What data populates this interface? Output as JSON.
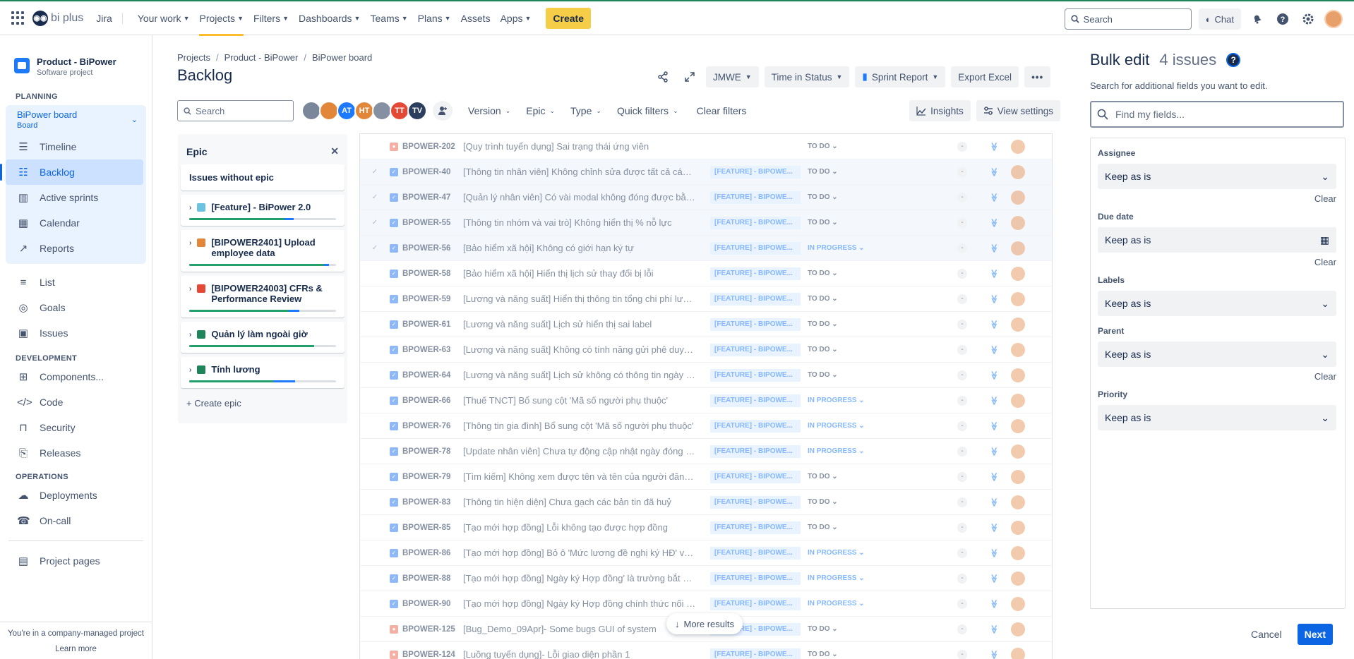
{
  "topbar": {
    "logo_text": "bi plus",
    "product": "Jira",
    "nav": [
      {
        "label": "Your work",
        "caret": true,
        "active": false
      },
      {
        "label": "Projects",
        "caret": true,
        "active": true
      },
      {
        "label": "Filters",
        "caret": true,
        "active": false
      },
      {
        "label": "Dashboards",
        "caret": true,
        "active": false
      },
      {
        "label": "Teams",
        "caret": true,
        "active": false
      },
      {
        "label": "Plans",
        "caret": true,
        "active": false
      },
      {
        "label": "Assets",
        "caret": false,
        "active": false
      },
      {
        "label": "Apps",
        "caret": true,
        "active": false
      }
    ],
    "create_label": "Create",
    "search_placeholder": "Search",
    "chat_label": "Chat"
  },
  "sidebar": {
    "project_name": "Product - BiPower",
    "project_type": "Software project",
    "planning_heading": "PLANNING",
    "board_name": "BiPower board",
    "board_sub": "Board",
    "planning_items": [
      {
        "label": "Timeline",
        "icon": "timeline-icon",
        "selected": false
      },
      {
        "label": "Backlog",
        "icon": "backlog-icon",
        "selected": true
      },
      {
        "label": "Active sprints",
        "icon": "sprints-icon",
        "selected": false
      },
      {
        "label": "Calendar",
        "icon": "calendar-icon",
        "selected": false
      },
      {
        "label": "Reports",
        "icon": "reports-icon",
        "selected": false
      }
    ],
    "other_items": [
      {
        "label": "List",
        "icon": "list-icon"
      },
      {
        "label": "Goals",
        "icon": "goals-icon"
      },
      {
        "label": "Issues",
        "icon": "issues-icon"
      }
    ],
    "development_heading": "DEVELOPMENT",
    "development_items": [
      {
        "label": "Components...",
        "icon": "components-icon"
      },
      {
        "label": "Code",
        "icon": "code-icon"
      },
      {
        "label": "Security",
        "icon": "lock-icon"
      },
      {
        "label": "Releases",
        "icon": "releases-icon"
      }
    ],
    "operations_heading": "OPERATIONS",
    "operations_items": [
      {
        "label": "Deployments",
        "icon": "deployments-icon"
      },
      {
        "label": "On-call",
        "icon": "on-call-icon"
      }
    ],
    "project_pages": "Project pages",
    "footer_text": "You're in a company-managed project",
    "learn_more": "Learn more"
  },
  "main": {
    "breadcrumbs": [
      "Projects",
      "Product - BiPower",
      "BiPower board"
    ],
    "title": "Backlog",
    "header_buttons": {
      "jmwe": "JMWE",
      "time_in_status": "Time in Status",
      "sprint_report": "Sprint Report",
      "export_excel": "Export Excel"
    },
    "search_placeholder": "Search",
    "avatars": [
      {
        "initials": "",
        "color": "#7a869a"
      },
      {
        "initials": "",
        "color": "#e2873a"
      },
      {
        "initials": "AT",
        "color": "#1d7afc"
      },
      {
        "initials": "HT",
        "color": "#e2873a"
      },
      {
        "initials": "",
        "color": "#8590a2"
      },
      {
        "initials": "TT",
        "color": "#e34935"
      },
      {
        "initials": "TV",
        "color": "#2c3e5d"
      }
    ],
    "filters": [
      "Version",
      "Epic",
      "Type",
      "Quick filters"
    ],
    "clear_filters": "Clear filters",
    "insights": "Insights",
    "view_settings": "View settings"
  },
  "epic_panel": {
    "title": "Epic",
    "no_epic": "Issues without epic",
    "epics": [
      {
        "name": "[Feature] - BiPower 2.0",
        "color": "#6cc3e0",
        "done": 0.65,
        "progress": 0.06
      },
      {
        "name": "[BIPOWER2401] Upload employee data",
        "color": "#e2873a",
        "done": 0.92,
        "progress": 0.03
      },
      {
        "name": "[BIPOWER24003] CFRs & Performance Review",
        "color": "#e34935",
        "done": 0.68,
        "progress": 0.07
      },
      {
        "name": "Quản lý làm ngoài giờ",
        "color": "#1f845a",
        "done": 0.85,
        "progress": 0.0
      },
      {
        "name": "Tính lương",
        "color": "#1f845a",
        "done": 0.57,
        "progress": 0.15
      }
    ],
    "create_epic": "Create epic"
  },
  "issues": [
    {
      "key": "BPOWER-202",
      "summary": "[Quy trình tuyển dụng] Sai trạng thái ứng viên",
      "epic": "",
      "status": "TO DO",
      "type": "bug",
      "selected": false,
      "checked": false
    },
    {
      "key": "BPOWER-40",
      "summary": "[Thông tin nhân viên] Không chỉnh sửa được tất cả các t...",
      "epic": "[FEATURE] - BIPOWE...",
      "status": "TO DO",
      "type": "task",
      "selected": true,
      "checked": true
    },
    {
      "key": "BPOWER-47",
      "summary": "[Quản lý nhân viên] Có vài modal không đóng được bằn...",
      "epic": "[FEATURE] - BIPOWE...",
      "status": "TO DO",
      "type": "task",
      "selected": true,
      "checked": true
    },
    {
      "key": "BPOWER-55",
      "summary": "[Thông tin nhóm và vai trò] Không hiển thị % nỗ lực",
      "epic": "[FEATURE] - BIPOWE...",
      "status": "TO DO",
      "type": "task",
      "selected": true,
      "checked": true
    },
    {
      "key": "BPOWER-56",
      "summary": "[Bảo hiểm xã hội] Không có giới hạn ký tự",
      "epic": "[FEATURE] - BIPOWE...",
      "status": "IN PROGRESS",
      "type": "task",
      "selected": true,
      "checked": true
    },
    {
      "key": "BPOWER-58",
      "summary": "[Bảo hiểm xã hội] Hiển thị lịch sử thay đổi bị lỗi",
      "epic": "[FEATURE] - BIPOWE...",
      "status": "TO DO",
      "type": "task",
      "selected": false,
      "checked": false
    },
    {
      "key": "BPOWER-59",
      "summary": "[Lương và năng suất] Hiển thị thông tin tổng chi phí lươn...",
      "epic": "[FEATURE] - BIPOWE...",
      "status": "TO DO",
      "type": "task",
      "selected": false,
      "checked": false
    },
    {
      "key": "BPOWER-61",
      "summary": "[Lương và năng suất] Lịch sử hiển thị sai label",
      "epic": "[FEATURE] - BIPOWE...",
      "status": "TO DO",
      "type": "task",
      "selected": false,
      "checked": false
    },
    {
      "key": "BPOWER-63",
      "summary": "[Lương và năng suất] Không có tính năng gửi phê duyệt ...",
      "epic": "[FEATURE] - BIPOWE...",
      "status": "TO DO",
      "type": "task",
      "selected": false,
      "checked": false
    },
    {
      "key": "BPOWER-64",
      "summary": "[Lương và năng suất] Lịch sử không có thông tin ngày t...",
      "epic": "[FEATURE] - BIPOWE...",
      "status": "TO DO",
      "type": "task",
      "selected": false,
      "checked": false
    },
    {
      "key": "BPOWER-66",
      "summary": "[Thuế TNCT] Bổ sung cột 'Mã số người phụ thuộc'",
      "epic": "[FEATURE] - BIPOWE...",
      "status": "IN PROGRESS",
      "type": "task",
      "selected": false,
      "checked": false
    },
    {
      "key": "BPOWER-76",
      "summary": "[Thông tin gia đình] Bổ sung cột 'Mã số người phụ thuộc'",
      "epic": "[FEATURE] - BIPOWE...",
      "status": "IN PROGRESS",
      "type": "task",
      "selected": false,
      "checked": false
    },
    {
      "key": "BPOWER-78",
      "summary": "[Update nhân viên] Chưa tự động cập nhật ngày đóng B...",
      "epic": "[FEATURE] - BIPOWE...",
      "status": "IN PROGRESS",
      "type": "task",
      "selected": false,
      "checked": false
    },
    {
      "key": "BPOWER-79",
      "summary": "[Tìm kiếm] Không xem được tên và tên của người đăng ký",
      "epic": "[FEATURE] - BIPOWE...",
      "status": "TO DO",
      "type": "task",
      "selected": false,
      "checked": false
    },
    {
      "key": "BPOWER-83",
      "summary": "[Thông tin hiện diện] Chưa gạch các bản tin đã huỷ",
      "epic": "[FEATURE] - BIPOWE...",
      "status": "TO DO",
      "type": "task",
      "selected": false,
      "checked": false
    },
    {
      "key": "BPOWER-85",
      "summary": "[Tạo mới hợp đồng] Lỗi không tạo được hợp đồng",
      "epic": "[FEATURE] - BIPOWE...",
      "status": "TO DO",
      "type": "task",
      "selected": false,
      "checked": false
    },
    {
      "key": "BPOWER-86",
      "summary": "[Tạo mới hợp đồng] Bỏ ô 'Mức lương đề nghị ký HĐ' với ...",
      "epic": "[FEATURE] - BIPOWE...",
      "status": "IN PROGRESS",
      "type": "task",
      "selected": false,
      "checked": false
    },
    {
      "key": "BPOWER-88",
      "summary": "[Tạo mới hợp đồng] Ngày ký Hợp đồng' là trường bắt bu...",
      "epic": "[FEATURE] - BIPOWE...",
      "status": "IN PROGRESS",
      "type": "task",
      "selected": false,
      "checked": false
    },
    {
      "key": "BPOWER-90",
      "summary": "[Tạo mới hợp đồng] Ngày ký Hợp đồng chính thức nối ti...",
      "epic": "[FEATURE] - BIPOWE...",
      "status": "IN PROGRESS",
      "type": "task",
      "selected": false,
      "checked": false
    },
    {
      "key": "BPOWER-125",
      "summary": "[Bug_Demo_09Apr]- Some bugs GUI of system",
      "epic": "[FEATURE] - BIPOWE...",
      "status": "TO DO",
      "type": "bug",
      "selected": false,
      "checked": false
    },
    {
      "key": "BPOWER-124",
      "summary": "[Luồng tuyển dụng]- Lỗi giao diện phần 1",
      "epic": "[FEATURE] - BIPOWE...",
      "status": "TO DO",
      "type": "bug",
      "selected": false,
      "checked": false
    }
  ],
  "more_results": "More results",
  "bulk_edit": {
    "title": "Bulk edit",
    "count": "4 issues",
    "description": "Search for additional fields you want to edit.",
    "find_placeholder": "Find my fields...",
    "fields": [
      {
        "label": "Assignee",
        "value": "Keep as is",
        "clear": "Clear",
        "control": "select"
      },
      {
        "label": "Due date",
        "value": "Keep as is",
        "clear": "Clear",
        "control": "date"
      },
      {
        "label": "Labels",
        "value": "Keep as is",
        "clear": "",
        "control": "select"
      },
      {
        "label": "Parent",
        "value": "Keep as is",
        "clear": "Clear",
        "control": "select"
      },
      {
        "label": "Priority",
        "value": "Keep as is",
        "clear": "",
        "control": "select"
      }
    ],
    "cancel": "Cancel",
    "next": "Next"
  }
}
